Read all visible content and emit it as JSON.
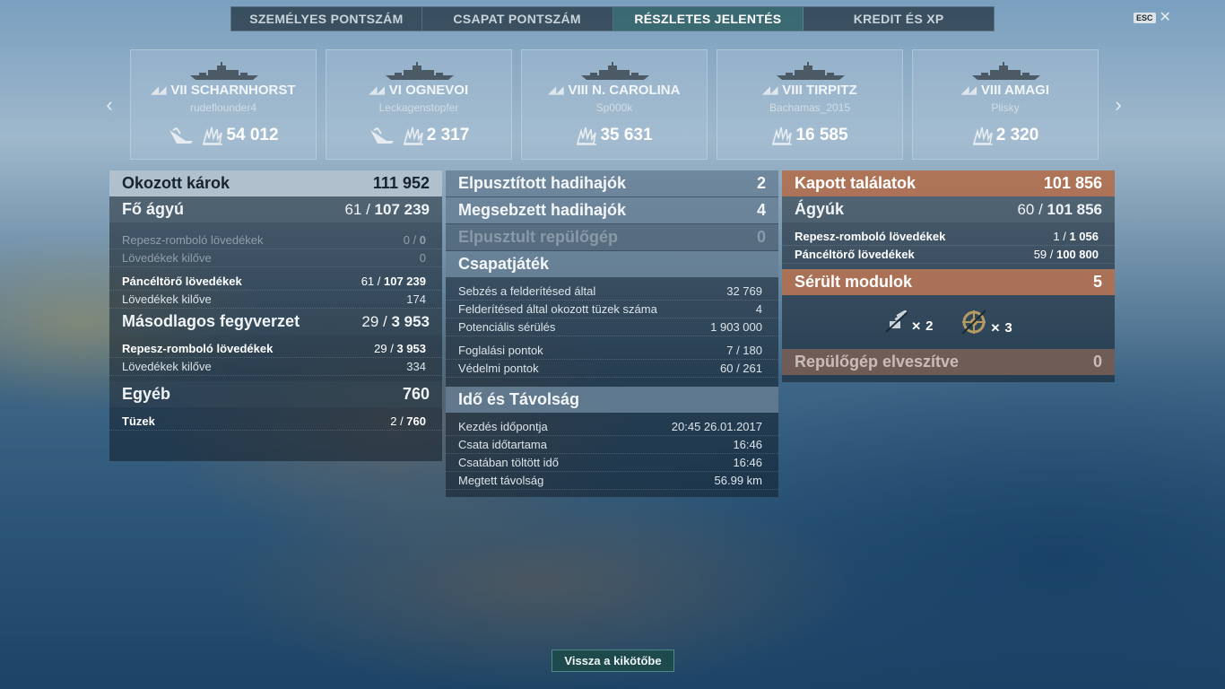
{
  "tabs": [
    {
      "label": "SZEMÉLYES PONTSZÁM"
    },
    {
      "label": "CSAPAT PONTSZÁM"
    },
    {
      "label": "RÉSZLETES JELENTÉS"
    },
    {
      "label": "KREDIT ÉS XP"
    }
  ],
  "esc": {
    "key": "ESC",
    "close": "✕"
  },
  "carousel": {
    "prev": "‹",
    "next": "›",
    "cards": [
      {
        "tier": "VII",
        "name": "VII SCHARNHORST",
        "player": "rudeflounder4",
        "damage": "54 012"
      },
      {
        "tier": "VI",
        "name": "VI OGNEVOI",
        "player": "Leckagenstopfer",
        "damage": "2 317"
      },
      {
        "tier": "VIII",
        "name": "VIII N. CAROLINA",
        "player": "Sp000k",
        "damage": "35 631"
      },
      {
        "tier": "VIII",
        "name": "VIII TIRPITZ",
        "player": "Bachamas_2015",
        "damage": "16 585"
      },
      {
        "tier": "VIII",
        "name": "VIII AMAGI",
        "player": "Plisky",
        "damage": "2 320"
      }
    ]
  },
  "left": {
    "caused": {
      "label": "Okozott károk",
      "value": "111 952"
    },
    "main": {
      "label": "Fő ágyú",
      "a": "61",
      "b": "107 239"
    },
    "he": {
      "label": "Repesz-romboló lövedékek",
      "a": "0",
      "b": "0"
    },
    "he_fired": {
      "label": "Lövedékek kilőve",
      "value": "0"
    },
    "ap": {
      "label": "Páncéltörő lövedékek",
      "a": "61",
      "b": "107 239"
    },
    "ap_fired": {
      "label": "Lövedékek kilőve",
      "value": "174"
    },
    "secondary": {
      "label": "Másodlagos fegyverzet",
      "a": "29",
      "b": "3 953"
    },
    "sec_he": {
      "label": "Repesz-romboló lövedékek",
      "a": "29",
      "b": "3 953"
    },
    "sec_fired": {
      "label": "Lövedékek kilőve",
      "value": "334"
    },
    "other": {
      "label": "Egyéb",
      "value": "760"
    },
    "fires": {
      "label": "Tüzek",
      "a": "2",
      "b": "760"
    }
  },
  "middle": {
    "destroyed": {
      "label": "Elpusztított hadihajók",
      "value": "2"
    },
    "damaged": {
      "label": "Megsebzett hadihajók",
      "value": "4"
    },
    "planes": {
      "label": "Elpusztult repülőgép",
      "value": "0"
    },
    "team": {
      "label": "Csapatjáték"
    },
    "spot_dmg": {
      "label": "Sebzés a felderítésed által",
      "value": "32 769"
    },
    "spot_fires": {
      "label": "Felderítésed által okozott tüzek száma",
      "value": "4"
    },
    "potential": {
      "label": "Potenciális sérülés",
      "value": "1 903 000"
    },
    "capture": {
      "label": "Foglalási pontok",
      "value": "7 / 180"
    },
    "defense": {
      "label": "Védelmi pontok",
      "value": "60 / 261"
    },
    "time": {
      "label": "Idő és Távolság"
    },
    "start": {
      "label": "Kezdés időpontja",
      "value": "20:45  26.01.2017"
    },
    "duration": {
      "label": "Csata időtartama",
      "value": "16:46"
    },
    "in_battle": {
      "label": "Csatában töltött idő",
      "value": "16:46"
    },
    "distance": {
      "label": "Megtett távolság",
      "value": "56.99 km"
    }
  },
  "right": {
    "received": {
      "label": "Kapott találatok",
      "value": "101 856"
    },
    "guns": {
      "label": "Ágyúk",
      "a": "60",
      "b": "101 856"
    },
    "he": {
      "label": "Repesz-romboló lövedékek",
      "a": "1",
      "b": "1 056"
    },
    "ap": {
      "label": "Páncéltörő lövedékek",
      "a": "59",
      "b": "100 800"
    },
    "modules": {
      "label": "Sérült modulok",
      "value": "5"
    },
    "mod_items": [
      {
        "icon": "gun-turret-icon",
        "count": "2"
      },
      {
        "icon": "steering-gear-icon",
        "count": "3"
      }
    ],
    "planes_lost": {
      "label": "Repülőgép elveszítve",
      "value": "0"
    }
  },
  "footer": {
    "back_button": "Vissza a kikötőbe"
  }
}
